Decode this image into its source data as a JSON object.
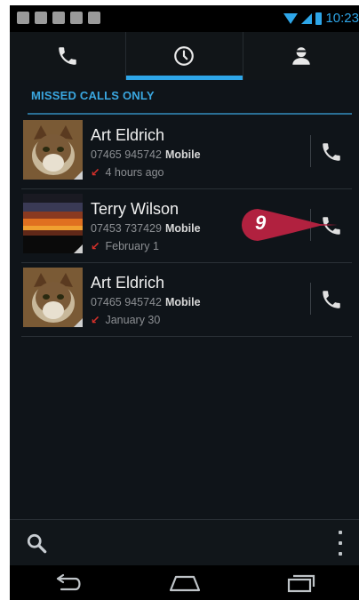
{
  "status_bar": {
    "time": "10:23"
  },
  "tabs": [
    {
      "name": "phone-icon",
      "selected": false
    },
    {
      "name": "clock-icon",
      "selected": true
    },
    {
      "name": "contact-icon",
      "selected": false
    }
  ],
  "filter": {
    "label": "MISSED CALLS ONLY"
  },
  "calls": [
    {
      "name": "Art Eldrich",
      "number": "07465 945742",
      "type": "Mobile",
      "time": "4 hours ago",
      "avatar": "cat-photo"
    },
    {
      "name": "Terry Wilson",
      "number": "07453 737429",
      "type": "Mobile",
      "time": "February 1",
      "avatar": "sunset-photo"
    },
    {
      "name": "Art Eldrich",
      "number": "07465 945742",
      "type": "Mobile",
      "time": "January 30",
      "avatar": "cat-photo"
    }
  ],
  "callout": {
    "step": "9"
  },
  "colors": {
    "accent": "#2ea6e8",
    "missed": "#d6302a",
    "callout": "#b1213f"
  },
  "icons": {
    "search": "search-icon",
    "overflow": "overflow-menu-icon",
    "back": "back-icon",
    "home": "home-icon",
    "recents": "recent-apps-icon"
  }
}
